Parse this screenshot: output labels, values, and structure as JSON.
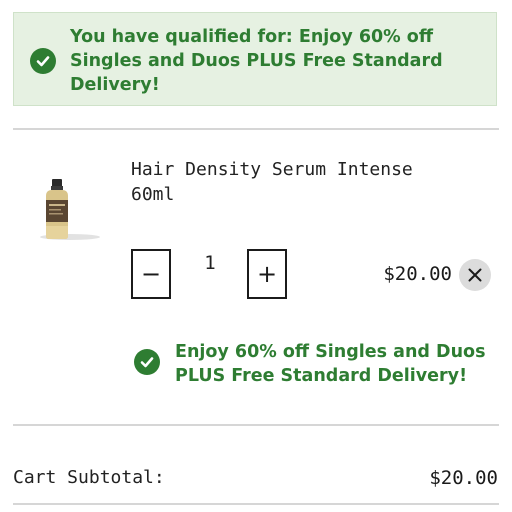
{
  "promo_banner": {
    "text": "You have qualified for: Enjoy 60% off Singles and Duos PLUS Free Standard Delivery!",
    "icon": "check-circle-icon",
    "background_color": "#e6f1e2",
    "text_color": "#2e7d32"
  },
  "cart_item": {
    "name": "Hair Density Serum Intense 60ml",
    "image": "serum-bottle",
    "quantity": "1",
    "decrease_label": "−",
    "increase_label": "+",
    "price": "$20.00",
    "remove_icon": "close-icon",
    "promo_text": "Enjoy 60% off Singles and Duos PLUS Free Standard Delivery!"
  },
  "cart_summary": {
    "subtotal_label": "Cart Subtotal:",
    "subtotal_value": "$20.00"
  }
}
